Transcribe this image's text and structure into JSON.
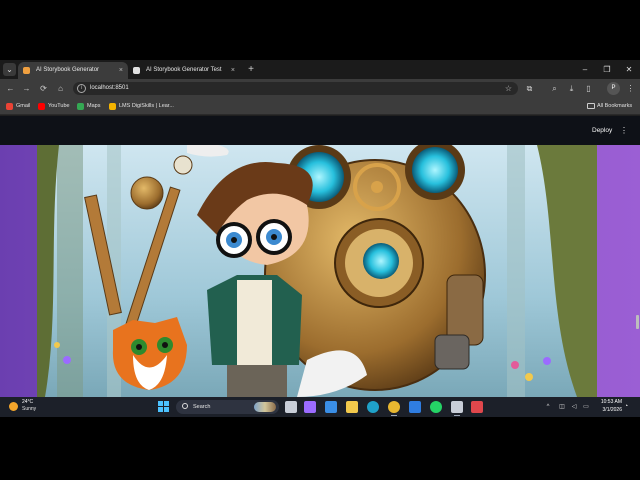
{
  "browser": {
    "tabs": [
      {
        "label": "AI Storybook Generator",
        "active": true,
        "favicon_color": "#f0a040"
      },
      {
        "label": "AI Storybook Generator Test",
        "active": false,
        "favicon_color": "#e0e0e0"
      }
    ],
    "tab_close_glyph": "×",
    "new_tab_glyph": "+",
    "window_controls": {
      "minimize": "–",
      "restore": "❐",
      "close": "✕"
    },
    "nav": {
      "back": "←",
      "forward": "→",
      "reload": "⟳",
      "home": "⌂"
    },
    "address": {
      "info_glyph": "i",
      "url": "localhost:8501",
      "star_glyph": "☆"
    },
    "toolbar_icons": {
      "extensions": "⧉",
      "download": "⤓",
      "tab_search": "⌕",
      "menu": "⋮"
    },
    "profile_initial": "P",
    "bookmarks": [
      {
        "label": "Gmail",
        "color": "#ea4335"
      },
      {
        "label": "YouTube",
        "color": "#ff0000"
      },
      {
        "label": "Maps",
        "color": "#34a853"
      },
      {
        "label": "LMS DigiSkills | Lear...",
        "color": "#f4b400"
      }
    ],
    "all_bookmarks": "All Bookmarks"
  },
  "app": {
    "deploy_label": "Deploy",
    "menu_glyph": "⋮",
    "image_subject": "storybook illustration"
  },
  "taskbar": {
    "weather": {
      "temp": "24°C",
      "condition": "Sunny"
    },
    "search_label": "Search",
    "apps": [
      {
        "name": "task-view",
        "color": "#c9ced8",
        "running": false
      },
      {
        "name": "copilot",
        "color": "#9b6bff",
        "running": false
      },
      {
        "name": "store",
        "color": "#3a8ee6",
        "running": false
      },
      {
        "name": "file-explorer",
        "color": "#f2c94c",
        "running": false
      },
      {
        "name": "edge",
        "color": "#1fa1c9",
        "running": false
      },
      {
        "name": "chrome",
        "color": "#e8b730",
        "running": true
      },
      {
        "name": "mail",
        "color": "#2f7de1",
        "running": false
      },
      {
        "name": "whatsapp",
        "color": "#25d366",
        "running": false
      },
      {
        "name": "streamlit",
        "color": "#c9ced8",
        "running": true
      },
      {
        "name": "snipping",
        "color": "#e0474c",
        "running": false
      }
    ],
    "tray": {
      "chevron": "^",
      "network": "◫",
      "volume": "◁",
      "battery": "▭"
    },
    "clock": {
      "time": "10:53 AM",
      "date": "3/1/2026"
    },
    "bell_glyph": "🔔"
  }
}
